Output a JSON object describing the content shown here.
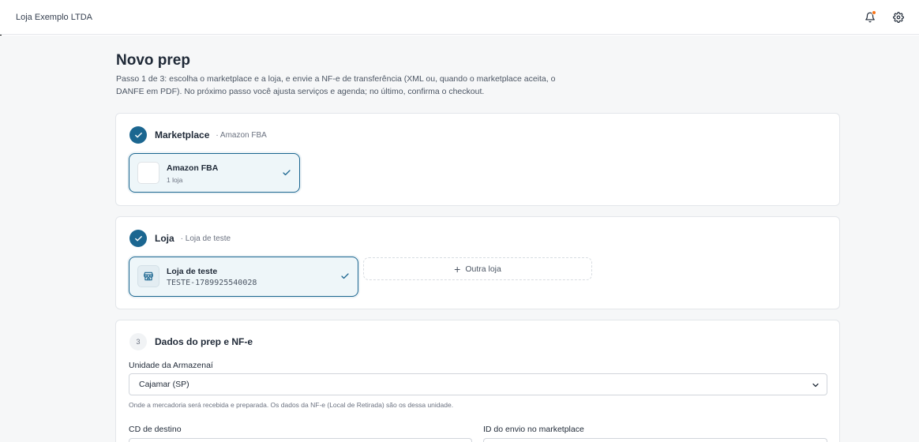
{
  "header": {
    "store_name": "Loja Exemplo LTDA",
    "icons": [
      "bell-icon",
      "gear-icon"
    ],
    "notification_dot_color": "#f97316"
  },
  "page": {
    "title": "Novo prep",
    "description": "Passo 1 de 3: escolha o marketplace e a loja, e envie a NF-e de transferência (XML ou, quando o marketplace aceita, o DANFE em PDF). No próximo passo você ajusta serviços e agenda; no último, confirma o checkout."
  },
  "marketplace_section": {
    "title": "Marketplace",
    "selected_summary": "· Amazon FBA",
    "option": {
      "name": "Amazon FBA",
      "stores_count": "1 loja"
    }
  },
  "store_section": {
    "title": "Loja",
    "selected_summary": "· Loja de teste",
    "option": {
      "name": "Loja de teste",
      "code": "TESTE-1789925540028"
    },
    "add_store_label": "Outra loja"
  },
  "prep_section": {
    "step_number": "3",
    "title": "Dados do prep e NF-e",
    "unit_label": "Unidade da Armazenaí",
    "unit_value": "Cajamar (SP)",
    "unit_hint": "Onde a mercadoria será recebida e preparada. Os dados da NF-e (Local de Retirada) são os dessa unidade.",
    "cd_label": "CD de destino",
    "shipment_id_label": "ID do envio no marketplace"
  },
  "colors": {
    "accent": "#1b6690",
    "selected_bg": "#eef6f9",
    "page_bg": "#f6f7f8"
  }
}
